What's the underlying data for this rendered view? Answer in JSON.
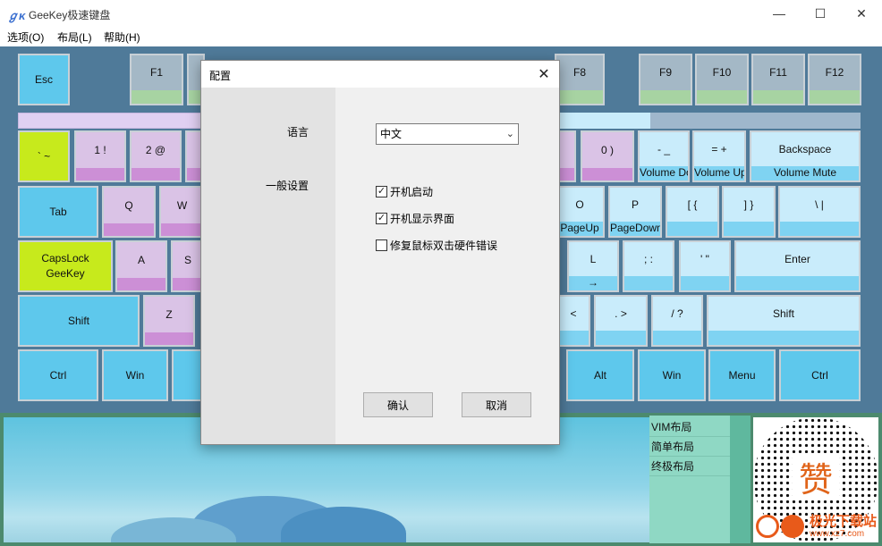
{
  "window": {
    "title": "GeeKey极速键盘",
    "icon": "gk-logo-icon"
  },
  "menu": [
    "选项(O)",
    "布局(L)",
    "帮助(H)"
  ],
  "function_row": [
    {
      "label": "Esc"
    },
    {
      "label": "F1"
    },
    {
      "label": "F8"
    },
    {
      "label": "F9"
    },
    {
      "label": "F10"
    },
    {
      "label": "F11"
    },
    {
      "label": "F12"
    }
  ],
  "number_row": [
    {
      "label": "` ~"
    },
    {
      "label": "1  !"
    },
    {
      "label": "2  @"
    },
    {
      "label": "0  )"
    },
    {
      "label": "-  _",
      "sub": "Volume Down"
    },
    {
      "label": "=  +",
      "sub": "Volume Up"
    },
    {
      "label": "Backspace",
      "sub": "Volume Mute"
    }
  ],
  "top_row": [
    {
      "label": "Tab"
    },
    {
      "label": "Q"
    },
    {
      "label": "W"
    },
    {
      "label": "O",
      "sub": "PageUp"
    },
    {
      "label": "P",
      "sub": "PageDown"
    },
    {
      "label": "[  {"
    },
    {
      "label": "]  }"
    },
    {
      "label": "\\  |"
    }
  ],
  "home_row": [
    {
      "label": "CapsLock\nGeeKey"
    },
    {
      "label": "A"
    },
    {
      "label": "S"
    },
    {
      "label": "L",
      "sub": "→"
    },
    {
      "label": ";  :"
    },
    {
      "label": "'  \""
    },
    {
      "label": "Enter"
    }
  ],
  "bottom_row": [
    {
      "label": "Shift"
    },
    {
      "label": "Z"
    },
    {
      "label": "<"
    },
    {
      "label": ".  >"
    },
    {
      "label": "/  ?"
    },
    {
      "label": "Shift"
    }
  ],
  "space_row": [
    {
      "label": "Ctrl"
    },
    {
      "label": "Win"
    },
    {
      "label": "Alt"
    },
    {
      "label": "Win"
    },
    {
      "label": "Menu"
    },
    {
      "label": "Ctrl"
    }
  ],
  "layouts": [
    "VIM布局",
    "简单布局",
    "终极布局"
  ],
  "qr": {
    "center_char": "赞"
  },
  "watermark": {
    "text": "极光下载站",
    "url": "www.xz7.com"
  },
  "dialog": {
    "title": "配置",
    "language_label": "语言",
    "general_label": "一般设置",
    "language_value": "中文",
    "options": [
      {
        "label": "开机启动",
        "checked": true
      },
      {
        "label": "开机显示界面",
        "checked": true
      },
      {
        "label": "修复鼠标双击硬件错误",
        "checked": false
      }
    ],
    "ok": "确认",
    "cancel": "取消"
  }
}
